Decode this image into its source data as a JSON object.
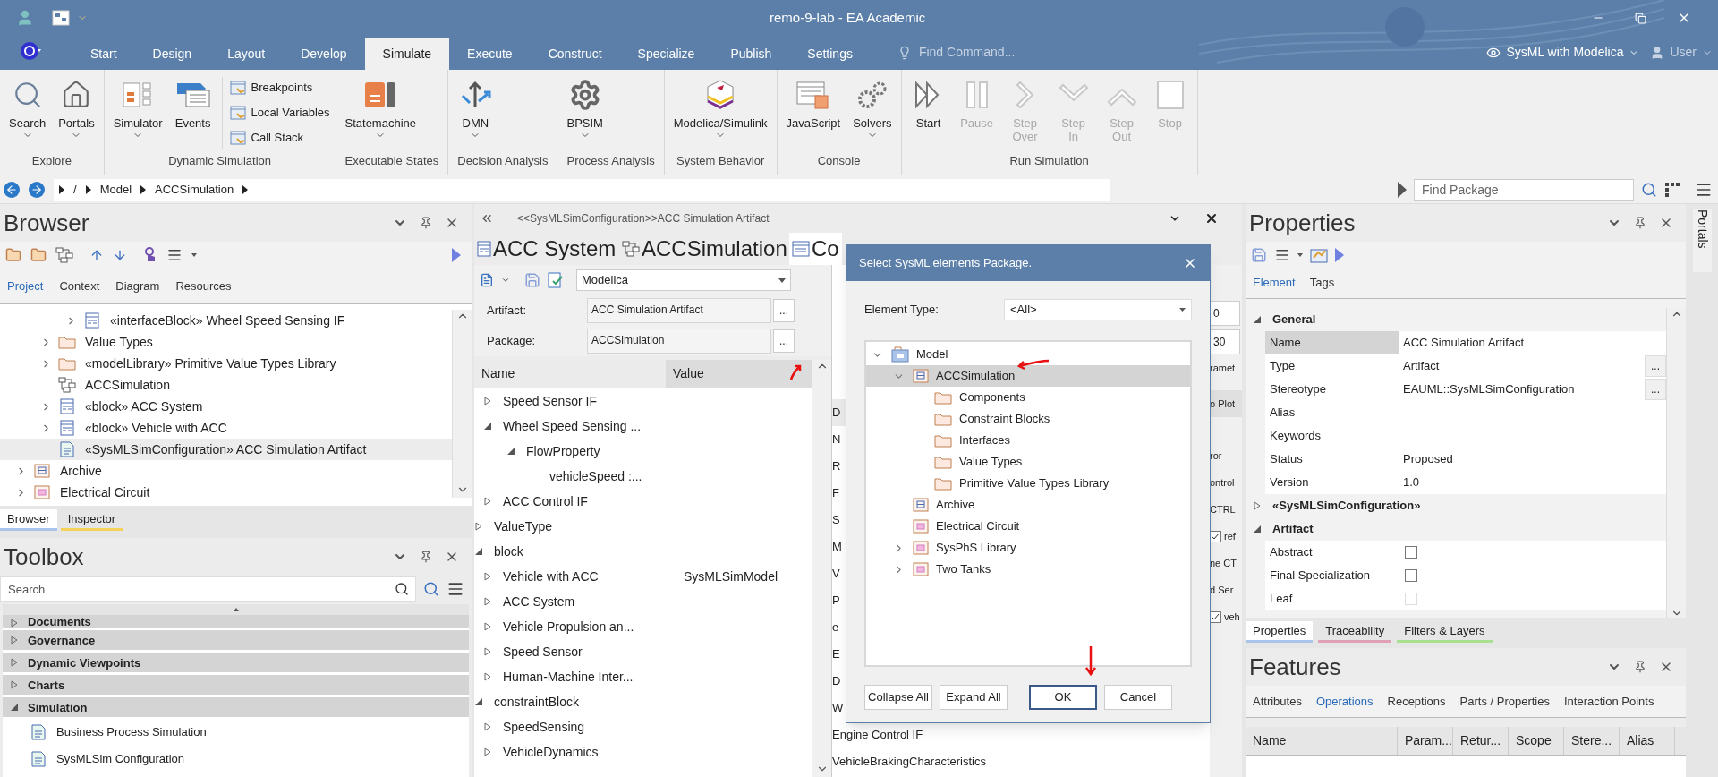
{
  "window": {
    "title": "remo-9-lab - EA Academic"
  },
  "ribbon_tabs": [
    {
      "label": "Start",
      "selected": false
    },
    {
      "label": "Design",
      "selected": false
    },
    {
      "label": "Layout",
      "selected": false
    },
    {
      "label": "Develop",
      "selected": false
    },
    {
      "label": "Simulate",
      "selected": true
    },
    {
      "label": "Execute",
      "selected": false
    },
    {
      "label": "Construct",
      "selected": false
    },
    {
      "label": "Specialize",
      "selected": false
    },
    {
      "label": "Publish",
      "selected": false
    },
    {
      "label": "Settings",
      "selected": false
    }
  ],
  "find_command": {
    "placeholder": "Find Command..."
  },
  "perspective": "SysML with Modelica",
  "user": "User",
  "ribbon_groups": [
    {
      "label": "Explore",
      "buttons": [
        {
          "label": "Search",
          "dropdown": true,
          "disabled": false
        },
        {
          "label": "Portals",
          "dropdown": true,
          "disabled": false
        }
      ]
    },
    {
      "label": "Dynamic Simulation",
      "buttons": [
        {
          "label": "Simulator",
          "dropdown": true,
          "disabled": false
        },
        {
          "label": "Events",
          "dropdown": false,
          "disabled": false
        }
      ],
      "small_buttons": [
        "Breakpoints",
        "Local Variables",
        "Call Stack"
      ]
    },
    {
      "label": "Executable States",
      "buttons": [
        {
          "label": "Statemachine",
          "dropdown": true,
          "disabled": false
        }
      ]
    },
    {
      "label": "Decision Analysis",
      "buttons": [
        {
          "label": "DMN",
          "dropdown": true,
          "disabled": false
        }
      ]
    },
    {
      "label": "Process Analysis",
      "buttons": [
        {
          "label": "BPSIM",
          "dropdown": true,
          "disabled": false
        }
      ]
    },
    {
      "label": "System Behavior",
      "buttons": [
        {
          "label": "Modelica/Simulink",
          "dropdown": true,
          "disabled": false
        }
      ]
    },
    {
      "label": "Console",
      "buttons": [
        {
          "label": "JavaScript",
          "dropdown": false,
          "disabled": false
        },
        {
          "label": "Solvers",
          "dropdown": true,
          "disabled": false
        }
      ]
    },
    {
      "label": "Run Simulation",
      "buttons": [
        {
          "label": "Start",
          "dropdown": false,
          "disabled": false
        },
        {
          "label": "Pause",
          "dropdown": false,
          "disabled": true
        },
        {
          "label": "Step Over",
          "dropdown": false,
          "disabled": true
        },
        {
          "label": "Step In",
          "dropdown": false,
          "disabled": true
        },
        {
          "label": "Step Out",
          "dropdown": false,
          "disabled": true
        },
        {
          "label": "Stop",
          "dropdown": false,
          "disabled": true
        }
      ]
    }
  ],
  "breadcrumb": [
    "/",
    "Model",
    "ACCSimulation"
  ],
  "find_package": {
    "placeholder": "Find Package"
  },
  "browser": {
    "title": "Browser",
    "tabs": [
      {
        "label": "Project",
        "selected": true
      },
      {
        "label": "Context",
        "selected": false
      },
      {
        "label": "Diagram",
        "selected": false
      },
      {
        "label": "Resources",
        "selected": false
      }
    ],
    "tree": [
      {
        "children": [
          {
            "children": [
              {
                "children": [
                  {
                    "label": "«interfaceBlock» Wheel Speed Sensing IF",
                    "kind": "block",
                    "expandable": true,
                    "selected": false
                  }
                ]
              }
            ]
          },
          {
            "children": [
              {
                "label": "Value Types",
                "kind": "folder",
                "expandable": true,
                "selected": false
              },
              {
                "label": "«modelLibrary» Primitive Value Types Library",
                "kind": "folder",
                "expandable": true,
                "selected": false
              },
              {
                "label": "ACCSimulation",
                "kind": "diagram",
                "expandable": false,
                "selected": false
              },
              {
                "label": "«block» ACC System",
                "kind": "block",
                "expandable": true,
                "selected": false
              },
              {
                "label": "«block» Vehicle with ACC",
                "kind": "block",
                "expandable": true,
                "selected": false
              },
              {
                "label": "«SysMLSimConfiguration» ACC Simulation Artifact",
                "kind": "artifact",
                "expandable": false,
                "selected": true
              }
            ]
          },
          {
            "label": "Archive",
            "kind": "package",
            "expandable": true,
            "selected": false
          },
          {
            "label": "Electrical Circuit",
            "kind": "pink_package",
            "expandable": true,
            "selected": false
          }
        ]
      }
    ],
    "bottom_tabs": [
      {
        "label": "Browser",
        "selected": true,
        "color": "#a9c4e8"
      },
      {
        "label": "Inspector",
        "selected": false,
        "color": "#f5d25a"
      }
    ]
  },
  "toolbox": {
    "title": "Toolbox",
    "search": {
      "placeholder": "Search"
    },
    "categories": [
      {
        "label": "Documents",
        "expanded": false
      },
      {
        "label": "Governance",
        "expanded": false
      },
      {
        "label": "Dynamic Viewpoints",
        "expanded": false
      },
      {
        "label": "Charts",
        "expanded": false
      },
      {
        "label": "Simulation",
        "expanded": true
      }
    ],
    "items": [
      "Business Process Simulation",
      "SysMLSim Configuration"
    ]
  },
  "editor": {
    "path": "<<SysMLSimConfiguration>>ACC Simulation Artifact",
    "tabs": [
      {
        "label": "ACC System",
        "kind": "block",
        "selected": false
      },
      {
        "label": "ACCSimulation",
        "kind": "diagram",
        "selected": false
      },
      {
        "label": "Co",
        "kind": "document",
        "selected": true
      }
    ],
    "language": "Modelica",
    "fields": [
      {
        "label": "Artifact:",
        "value": "ACC Simulation Artifact",
        "button": "..."
      },
      {
        "label": "Package:",
        "value": "ACCSimulation",
        "button": "..."
      }
    ],
    "columns": [
      "Name",
      "Value"
    ],
    "tree": [
      {
        "children": [
          {
            "label": "Speed Sensor IF",
            "expanded": false
          },
          {
            "label": "Wheel Speed Sensing ...",
            "expanded": true,
            "children": [
              {
                "label": "FlowProperty",
                "expanded": true,
                "children": [
                  {
                    "label": "vehicleSpeed :..."
                  }
                ]
              }
            ]
          },
          {
            "label": "ACC Control IF",
            "expanded": false
          }
        ]
      },
      {
        "label": "ValueType",
        "expanded": false
      },
      {
        "label": "block",
        "expanded": true,
        "children": [
          {
            "label": "Vehicle with ACC",
            "value": "SysMLSimModel",
            "expanded": false
          },
          {
            "label": "ACC System",
            "expanded": false
          },
          {
            "label": "Vehicle Propulsion an...",
            "expanded": false
          },
          {
            "label": "Speed Sensor",
            "expanded": false
          },
          {
            "label": "Human-Machine Inter...",
            "expanded": false
          }
        ]
      },
      {
        "label": "constraintBlock",
        "expanded": true,
        "children": [
          {
            "label": "SpeedSensing",
            "expanded": false
          },
          {
            "label": "VehicleDynamics",
            "expanded": false
          }
        ]
      }
    ],
    "side_panel": {
      "tab": "D",
      "rows": [
        "N",
        "R",
        "F",
        "S",
        "M",
        "V",
        "P",
        "e",
        "E",
        "D",
        "W",
        "Engine Control IF",
        "VehicleBrakingCharacteristics"
      ],
      "items": [
        {
          "kind": "field",
          "text": "0"
        },
        {
          "kind": "field",
          "text": "30"
        },
        {
          "kind": "text",
          "text": "ramet"
        },
        {
          "kind": "tab",
          "text": "o Plot"
        },
        {
          "kind": "text",
          "text": "ror"
        },
        {
          "kind": "text",
          "text": "ontrol"
        },
        {
          "kind": "text",
          "text": "CTRL"
        },
        {
          "kind": "checkbox",
          "text": "ref",
          "checked": true
        },
        {
          "kind": "text",
          "text": "ne CT"
        },
        {
          "kind": "text",
          "text": "d Ser"
        },
        {
          "kind": "checkbox",
          "text": "veh",
          "checked": true
        }
      ]
    }
  },
  "dialog": {
    "title": "Select SysML elements Package.",
    "element_type": {
      "label": "Element Type:",
      "value": "<All>"
    },
    "tree": [
      {
        "label": "Model",
        "kind": "model",
        "expandable": true,
        "expanded": true,
        "selected": false,
        "children": [
          {
            "label": "ACCSimulation",
            "kind": "package",
            "expandable": true,
            "expanded": true,
            "selected": true,
            "children": [
              {
                "label": "Components",
                "kind": "folder",
                "expandable": false,
                "selected": false
              },
              {
                "label": "Constraint Blocks",
                "kind": "folder",
                "expandable": false,
                "selected": false
              },
              {
                "label": "Interfaces",
                "kind": "folder",
                "expandable": false,
                "selected": false
              },
              {
                "label": "Value Types",
                "kind": "folder",
                "expandable": false,
                "selected": false
              },
              {
                "label": "Primitive Value Types Library",
                "kind": "folder",
                "expandable": false,
                "selected": false
              }
            ]
          },
          {
            "label": "Archive",
            "kind": "package",
            "expandable": false,
            "selected": false
          },
          {
            "label": "Electrical Circuit",
            "kind": "pink_package",
            "expandable": false,
            "selected": false
          },
          {
            "label": "SysPhS Library",
            "kind": "pink_package",
            "expandable": true,
            "expanded": false,
            "selected": false
          },
          {
            "label": "Two Tanks",
            "kind": "pink_package",
            "expandable": true,
            "expanded": false,
            "selected": false
          }
        ]
      }
    ],
    "buttons": [
      {
        "label": "Collapse All",
        "default": false
      },
      {
        "label": "Expand All",
        "default": false
      },
      {
        "label": "OK",
        "default": true
      },
      {
        "label": "Cancel",
        "default": false
      }
    ]
  },
  "properties": {
    "title": "Properties",
    "tabs": [
      {
        "label": "Element",
        "selected": true
      },
      {
        "label": "Tags",
        "selected": false
      }
    ],
    "sections": [
      {
        "label": "General",
        "expanded": true,
        "rows": [
          {
            "kind": "text",
            "name": "Name",
            "value": "ACC Simulation Artifact",
            "selected": true
          },
          {
            "kind": "text",
            "name": "Type",
            "value": "Artifact",
            "selected": false,
            "button": "..."
          },
          {
            "kind": "text",
            "name": "Stereotype",
            "value": "EAUML::SysMLSimConfiguration",
            "selected": false,
            "button": "..."
          },
          {
            "kind": "text",
            "name": "Alias",
            "selected": false
          },
          {
            "kind": "text",
            "name": "Keywords",
            "selected": false
          },
          {
            "kind": "text",
            "name": "Status",
            "value": "Proposed",
            "selected": false
          },
          {
            "kind": "text",
            "name": "Version",
            "value": "1.0",
            "selected": false
          }
        ]
      },
      {
        "label": "«SysMLSimConfiguration»",
        "expanded": false
      },
      {
        "label": "Artifact",
        "expanded": true,
        "rows": [
          {
            "kind": "checkbox",
            "name": "Abstract",
            "checked": false,
            "disabled": false,
            "selected": false
          },
          {
            "kind": "checkbox",
            "name": "Final Specialization",
            "checked": false,
            "disabled": false,
            "selected": false
          },
          {
            "kind": "checkbox",
            "name": "Leaf",
            "checked": false,
            "disabled": true,
            "selected": false
          }
        ]
      }
    ],
    "bottom_tabs": [
      {
        "label": "Properties",
        "selected": true,
        "color": "#a9c4e8"
      },
      {
        "label": "Traceability",
        "selected": false,
        "color": "#e0a0b8"
      },
      {
        "label": "Filters & Layers",
        "selected": false,
        "color": "#a8e090"
      }
    ]
  },
  "features": {
    "title": "Features",
    "tabs": [
      {
        "label": "Attributes",
        "selected": false
      },
      {
        "label": "Operations",
        "selected": true
      },
      {
        "label": "Receptions",
        "selected": false
      },
      {
        "label": "Parts / Properties",
        "selected": false
      },
      {
        "label": "Interaction Points",
        "selected": false
      }
    ],
    "columns": [
      "Name",
      "Param...",
      "Retur...",
      "Scope",
      "Stere...",
      "Alias"
    ]
  },
  "portals": "Portals"
}
